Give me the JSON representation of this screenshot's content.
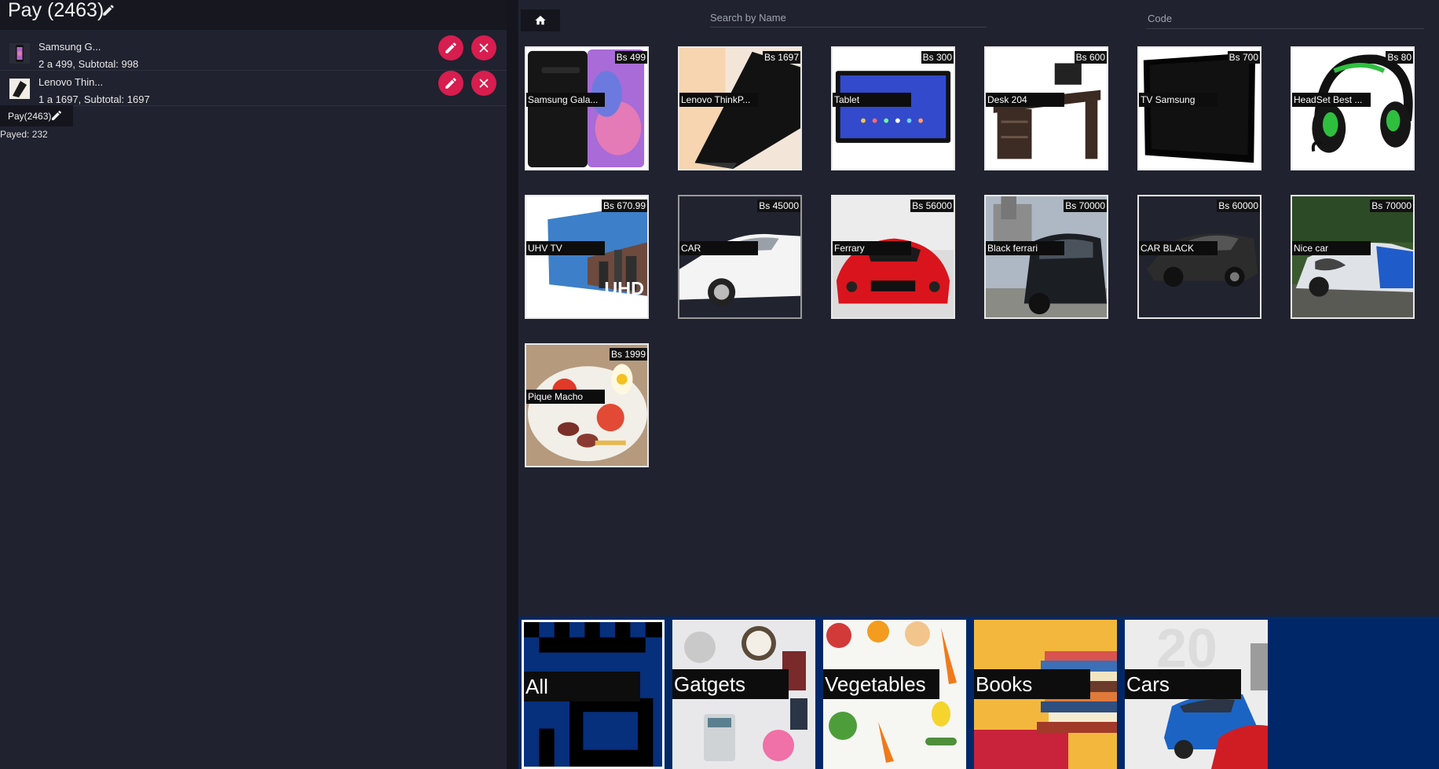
{
  "cart": {
    "title": "Pay (2463)",
    "items": [
      {
        "name": "Samsung G...",
        "detail": "2 a 499, Subtotal: 998",
        "thumb_icon": "phone-thumbnail"
      },
      {
        "name": "Lenovo Thin...",
        "detail": "1 a 1697, Subtotal: 1697",
        "thumb_icon": "laptop-thumbnail"
      }
    ],
    "pay_chip": "Pay(2463)",
    "payed": "Payed: 232"
  },
  "toolbar": {
    "home_icon": "home-icon",
    "search_placeholder": "Search by Name",
    "code_placeholder": "Code"
  },
  "products": [
    {
      "name": "Samsung Gala...",
      "price": "Bs 499",
      "image": "smartphone"
    },
    {
      "name": "Lenovo ThinkP...",
      "price": "Bs 1697",
      "image": "laptop"
    },
    {
      "name": "Tablet",
      "price": "Bs 300",
      "image": "tablet"
    },
    {
      "name": "Desk 204",
      "price": "Bs 600",
      "image": "desk"
    },
    {
      "name": "TV Samsung",
      "price": "Bs 700",
      "image": "tv"
    },
    {
      "name": "HeadSet Best ...",
      "price": "Bs 80",
      "image": "headset"
    },
    {
      "name": "UHV TV",
      "price": "Bs 670.99",
      "image": "uhd-tv",
      "image_text": "UHD TV"
    },
    {
      "name": "CAR",
      "price": "Bs 45000",
      "image": "white-car"
    },
    {
      "name": "Ferrary",
      "price": "Bs 56000",
      "image": "red-ferrari"
    },
    {
      "name": "Black ferrari",
      "price": "Bs 70000",
      "image": "black-suv"
    },
    {
      "name": "CAR BLACK",
      "price": "Bs 60000",
      "image": "black-car"
    },
    {
      "name": "Nice car",
      "price": "Bs 70000",
      "image": "camo-car"
    },
    {
      "name": "Pique Macho",
      "price": "Bs 1999",
      "image": "food-plate"
    }
  ],
  "categories": [
    {
      "label": "All",
      "image": "qr-pattern",
      "selected": true
    },
    {
      "label": "Gatgets",
      "image": "gadgets-flatlay"
    },
    {
      "label": "Vegetables",
      "image": "vegetables"
    },
    {
      "label": "Books",
      "image": "book-stack"
    },
    {
      "label": "Cars",
      "image": "cars-lineup"
    }
  ],
  "colors": {
    "background": "#20222f",
    "header": "#16171f",
    "accent_red": "#d81d4f",
    "category_bar": "#002868"
  }
}
